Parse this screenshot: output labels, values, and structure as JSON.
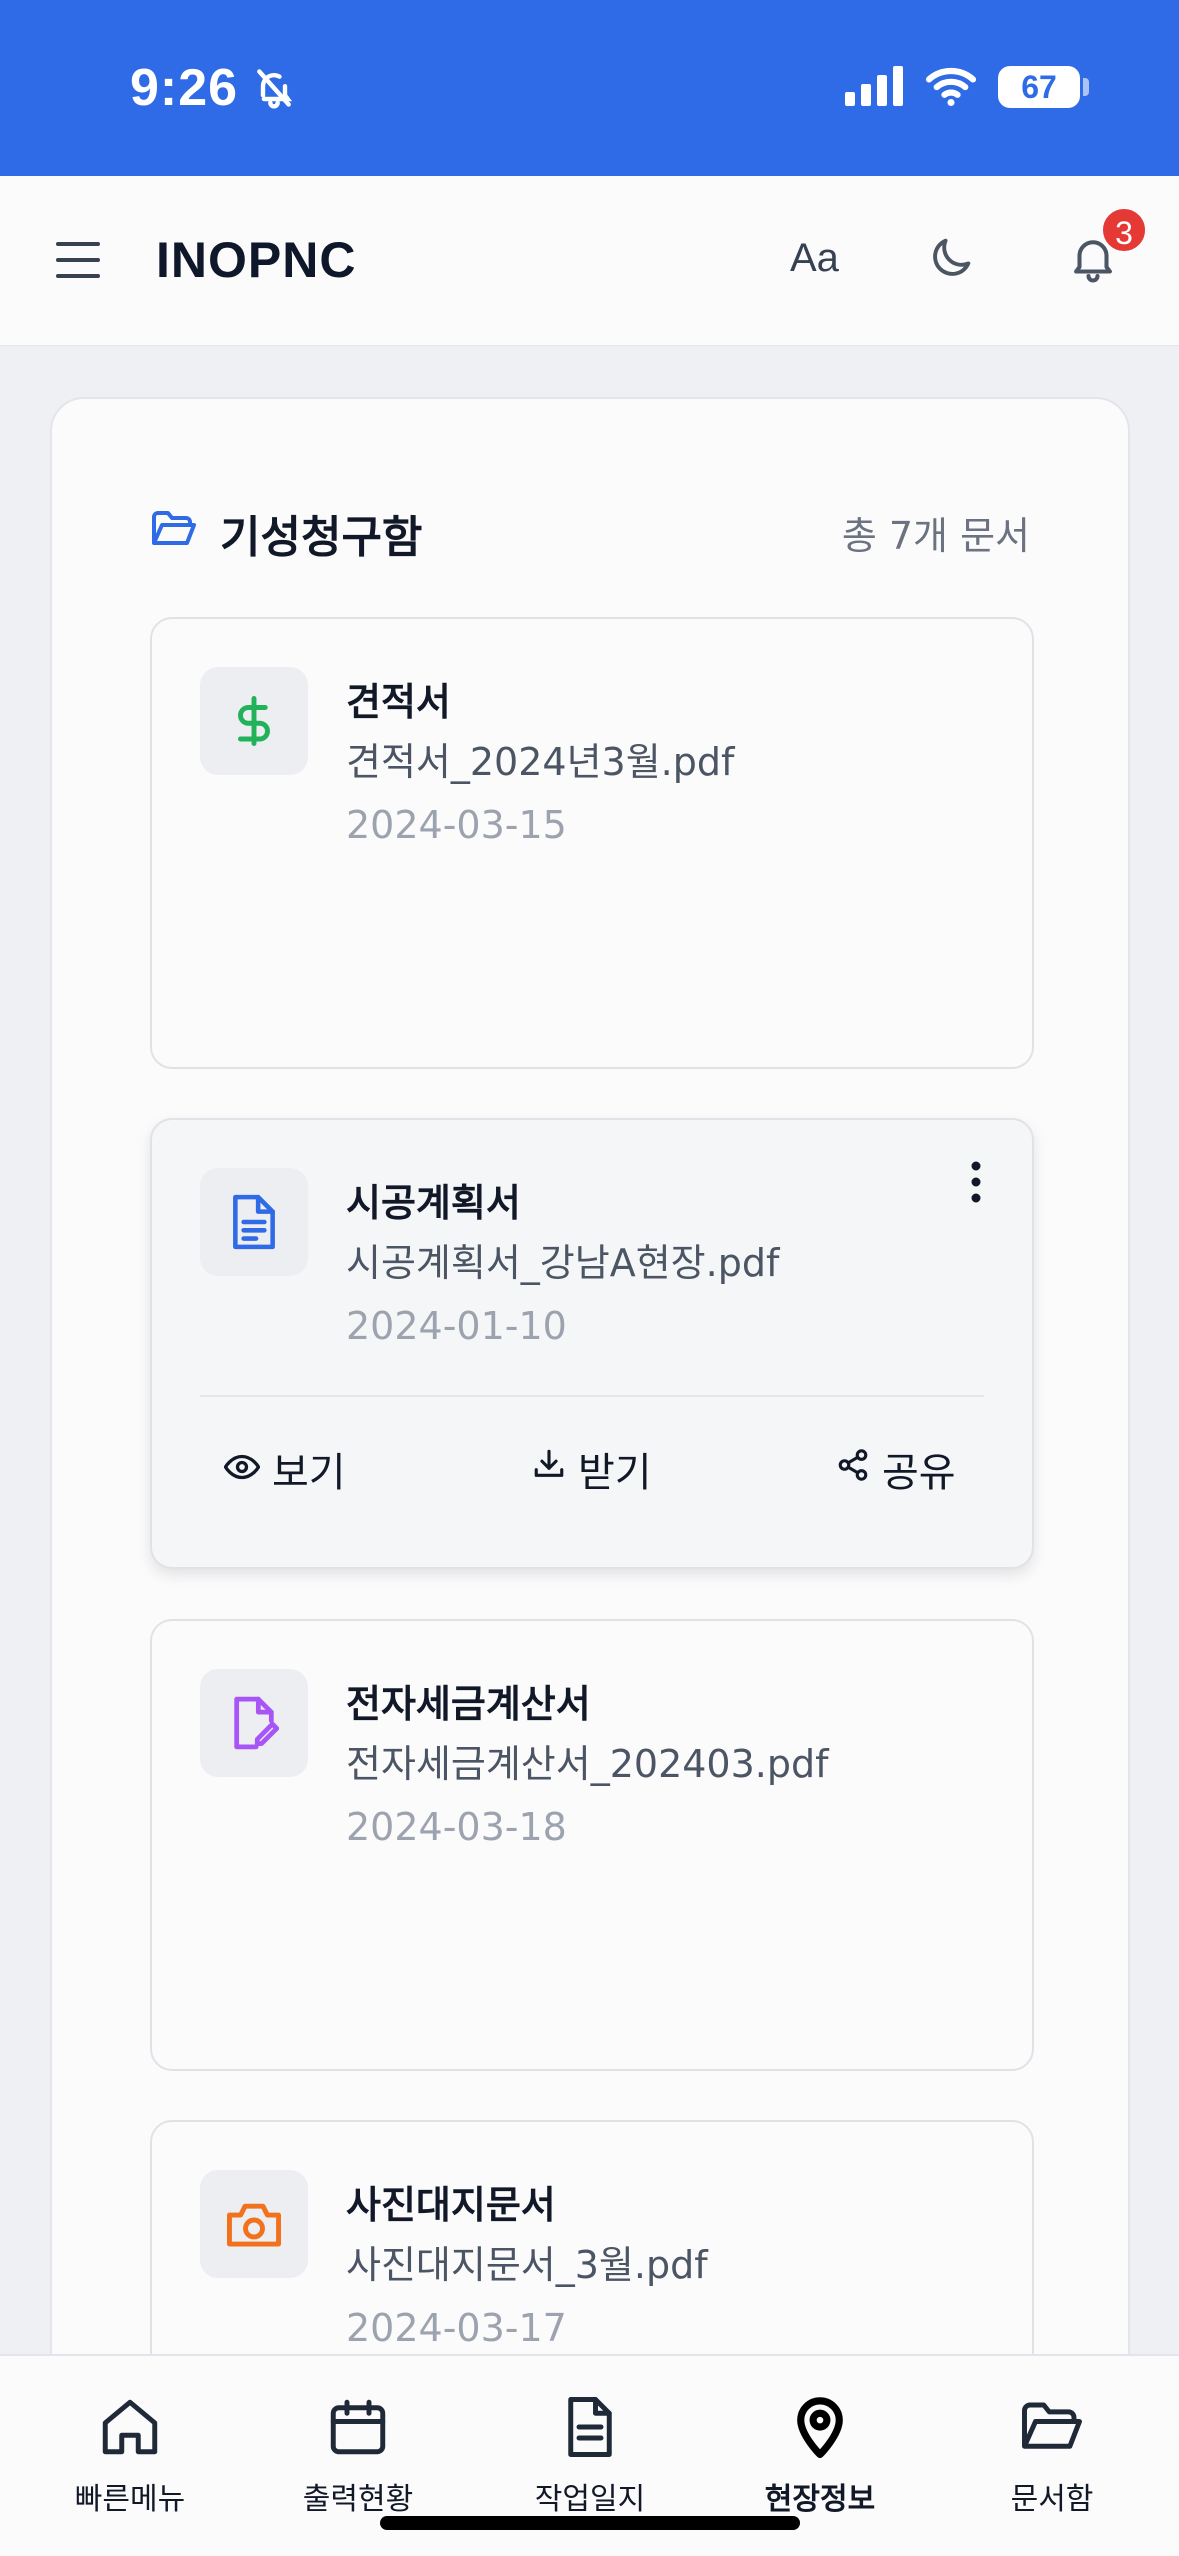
{
  "status_bar": {
    "time": "9:26",
    "battery": "67",
    "icons": [
      "bell-slash-icon",
      "signal-icon",
      "wifi-icon",
      "battery-icon"
    ]
  },
  "header": {
    "title": "INOPNC",
    "font_size_label": "Aa",
    "notification_count": "3",
    "icons": [
      "menu-icon",
      "moon-icon",
      "bell-icon"
    ]
  },
  "section": {
    "title": "기성청구함",
    "count_label": "총 7개 문서",
    "icon": "folder-open-icon"
  },
  "documents": [
    {
      "title": "견적서",
      "file": "견적서_2024년3월.pdf",
      "date": "2024-03-15",
      "icon": "dollar-icon",
      "icon_color": "#22b35a"
    },
    {
      "title": "시공계획서",
      "file": "시공계획서_강남A현장.pdf",
      "date": "2024-01-10",
      "icon": "document-icon",
      "icon_color": "#2f6be6"
    },
    {
      "title": "전자세금계산서",
      "file": "전자세금계산서_202403.pdf",
      "date": "2024-03-18",
      "icon": "file-edit-icon",
      "icon_color": "#a855f7"
    },
    {
      "title": "사진대지문서",
      "file": "사진대지문서_3월.pdf",
      "date": "2024-03-17",
      "icon": "camera-icon",
      "icon_color": "#f2711c"
    }
  ],
  "actions": {
    "view": "보기",
    "download": "받기",
    "share": "공유"
  },
  "bottom_nav": [
    {
      "label": "빠른메뉴",
      "icon": "home-icon"
    },
    {
      "label": "출력현황",
      "icon": "calendar-icon"
    },
    {
      "label": "작업일지",
      "icon": "file-text-icon"
    },
    {
      "label": "현장정보",
      "icon": "map-pin-icon",
      "active": true
    },
    {
      "label": "문서함",
      "icon": "folder-open-icon"
    }
  ],
  "colors": {
    "status_bar": "#2f6be6",
    "badge": "#e53935",
    "page_bg": "#eef0f4"
  }
}
